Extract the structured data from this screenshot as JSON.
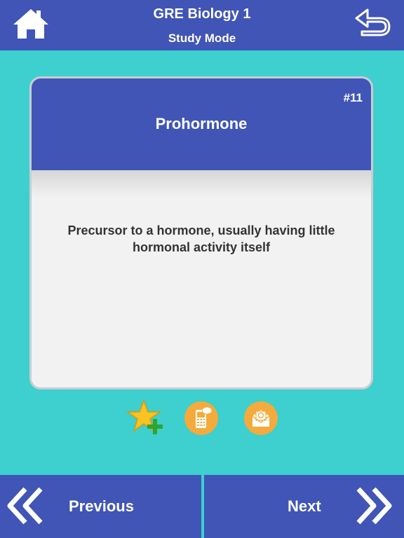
{
  "header": {
    "title": "GRE Biology 1",
    "subtitle": "Study Mode",
    "home_icon": "home-icon",
    "back_icon": "undo-arrow-icon"
  },
  "card": {
    "number": "#11",
    "term": "Prohormone",
    "definition": "Precursor to a hormone, usually having little hormonal activity itself"
  },
  "actions": {
    "favorite_icon": "star-plus-icon",
    "sms_icon": "sms-phone-icon",
    "email_icon": "email-envelope-icon"
  },
  "footer": {
    "previous_label": "Previous",
    "next_label": "Next"
  },
  "colors": {
    "background": "#3ecfcf",
    "primary": "#4055b5",
    "card_body": "#f2f2f2",
    "action_orange": "#f4ab3c"
  }
}
